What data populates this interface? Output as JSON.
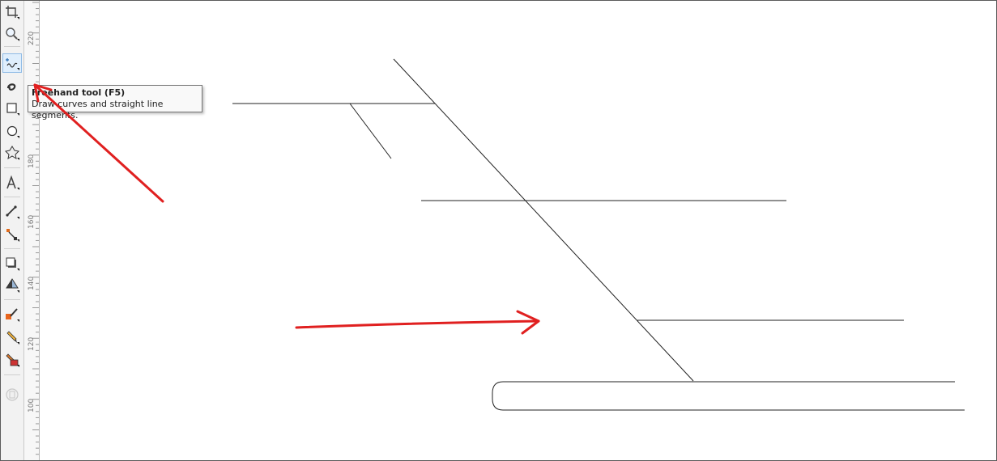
{
  "toolbox": {
    "tools": [
      {
        "name": "crop-tool",
        "icon": "crop-icon"
      },
      {
        "name": "zoom-tool",
        "icon": "magnifier-icon"
      },
      {
        "name": "freehand-tool",
        "icon": "freehand-icon",
        "active": true
      },
      {
        "name": "artistic-media-tool",
        "icon": "artistic-media-icon"
      },
      {
        "name": "rectangle-tool",
        "icon": "rectangle-icon"
      },
      {
        "name": "ellipse-tool",
        "icon": "ellipse-icon"
      },
      {
        "name": "polygon-tool",
        "icon": "polygon-icon"
      },
      {
        "name": "text-tool",
        "icon": "text-icon"
      },
      {
        "name": "dimension-tool",
        "icon": "dimension-icon"
      },
      {
        "name": "connector-tool",
        "icon": "connector-icon"
      },
      {
        "name": "drop-shadow-tool",
        "icon": "drop-shadow-icon"
      },
      {
        "name": "transparency-tool",
        "icon": "transparency-icon"
      },
      {
        "name": "color-eyedropper-tool",
        "icon": "eyedropper-icon"
      },
      {
        "name": "outline-tool",
        "icon": "outline-pen-icon"
      },
      {
        "name": "smart-fill-tool",
        "icon": "fill-icon"
      },
      {
        "name": "disabled-tool",
        "icon": "disabled-icon"
      }
    ]
  },
  "ruler": {
    "labels": [
      "220",
      "180",
      "160",
      "140",
      "120",
      "100"
    ]
  },
  "tooltip": {
    "title": "Freehand tool (F5)",
    "description": "Draw curves and straight line segments."
  },
  "annotations": {
    "arrow_color": "#e02020"
  }
}
